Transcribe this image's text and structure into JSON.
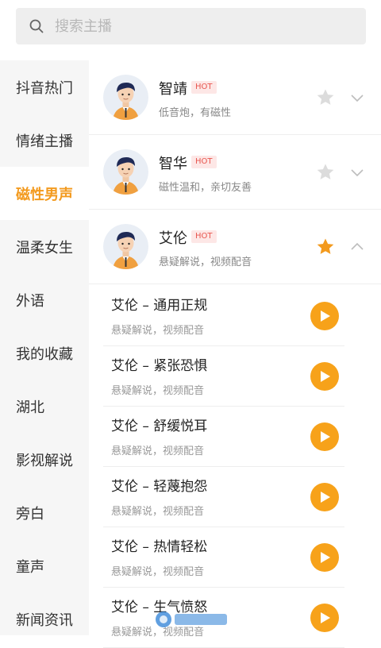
{
  "search": {
    "placeholder": "搜索主播",
    "value": ""
  },
  "sidebar": {
    "items": [
      {
        "label": "抖音热门"
      },
      {
        "label": "情绪主播"
      },
      {
        "label": "磁性男声",
        "active": true
      },
      {
        "label": "温柔女生"
      },
      {
        "label": "外语"
      },
      {
        "label": "我的收藏"
      },
      {
        "label": "湖北"
      },
      {
        "label": "影视解说"
      },
      {
        "label": "旁白"
      },
      {
        "label": "童声"
      },
      {
        "label": "新闻资讯"
      }
    ]
  },
  "anchors": [
    {
      "name": "智靖",
      "badge": "HOT",
      "desc": "低音炮，有磁性",
      "favorited": false,
      "expanded": false
    },
    {
      "name": "智华",
      "badge": "HOT",
      "desc": "磁性温和，亲切友善",
      "favorited": false,
      "expanded": false
    },
    {
      "name": "艾伦",
      "badge": "HOT",
      "desc": "悬疑解说，视频配音",
      "favorited": true,
      "expanded": true
    }
  ],
  "samples": [
    {
      "title": "艾伦 – 通用正规",
      "desc": "悬疑解说，视频配音"
    },
    {
      "title": "艾伦 – 紧张恐惧",
      "desc": "悬疑解说，视频配音"
    },
    {
      "title": "艾伦 – 舒缓悦耳",
      "desc": "悬疑解说，视频配音"
    },
    {
      "title": "艾伦 – 轻蔑抱怨",
      "desc": "悬疑解说，视频配音"
    },
    {
      "title": "艾伦 – 热情轻松",
      "desc": "悬疑解说，视频配音"
    },
    {
      "title": "艾伦 – 生气愤怒",
      "desc": "悬疑解说，视频配音"
    }
  ],
  "colors": {
    "accent": "#f39a1e",
    "play": "#f7a21a",
    "star_on": "#f39a1e",
    "star_off": "#dcdcdc",
    "hot_text": "#e8564f"
  },
  "icons": {
    "search": "search-icon",
    "star": "star-icon",
    "chevron_down": "chevron-down-icon",
    "chevron_up": "chevron-up-icon",
    "play": "play-icon"
  }
}
